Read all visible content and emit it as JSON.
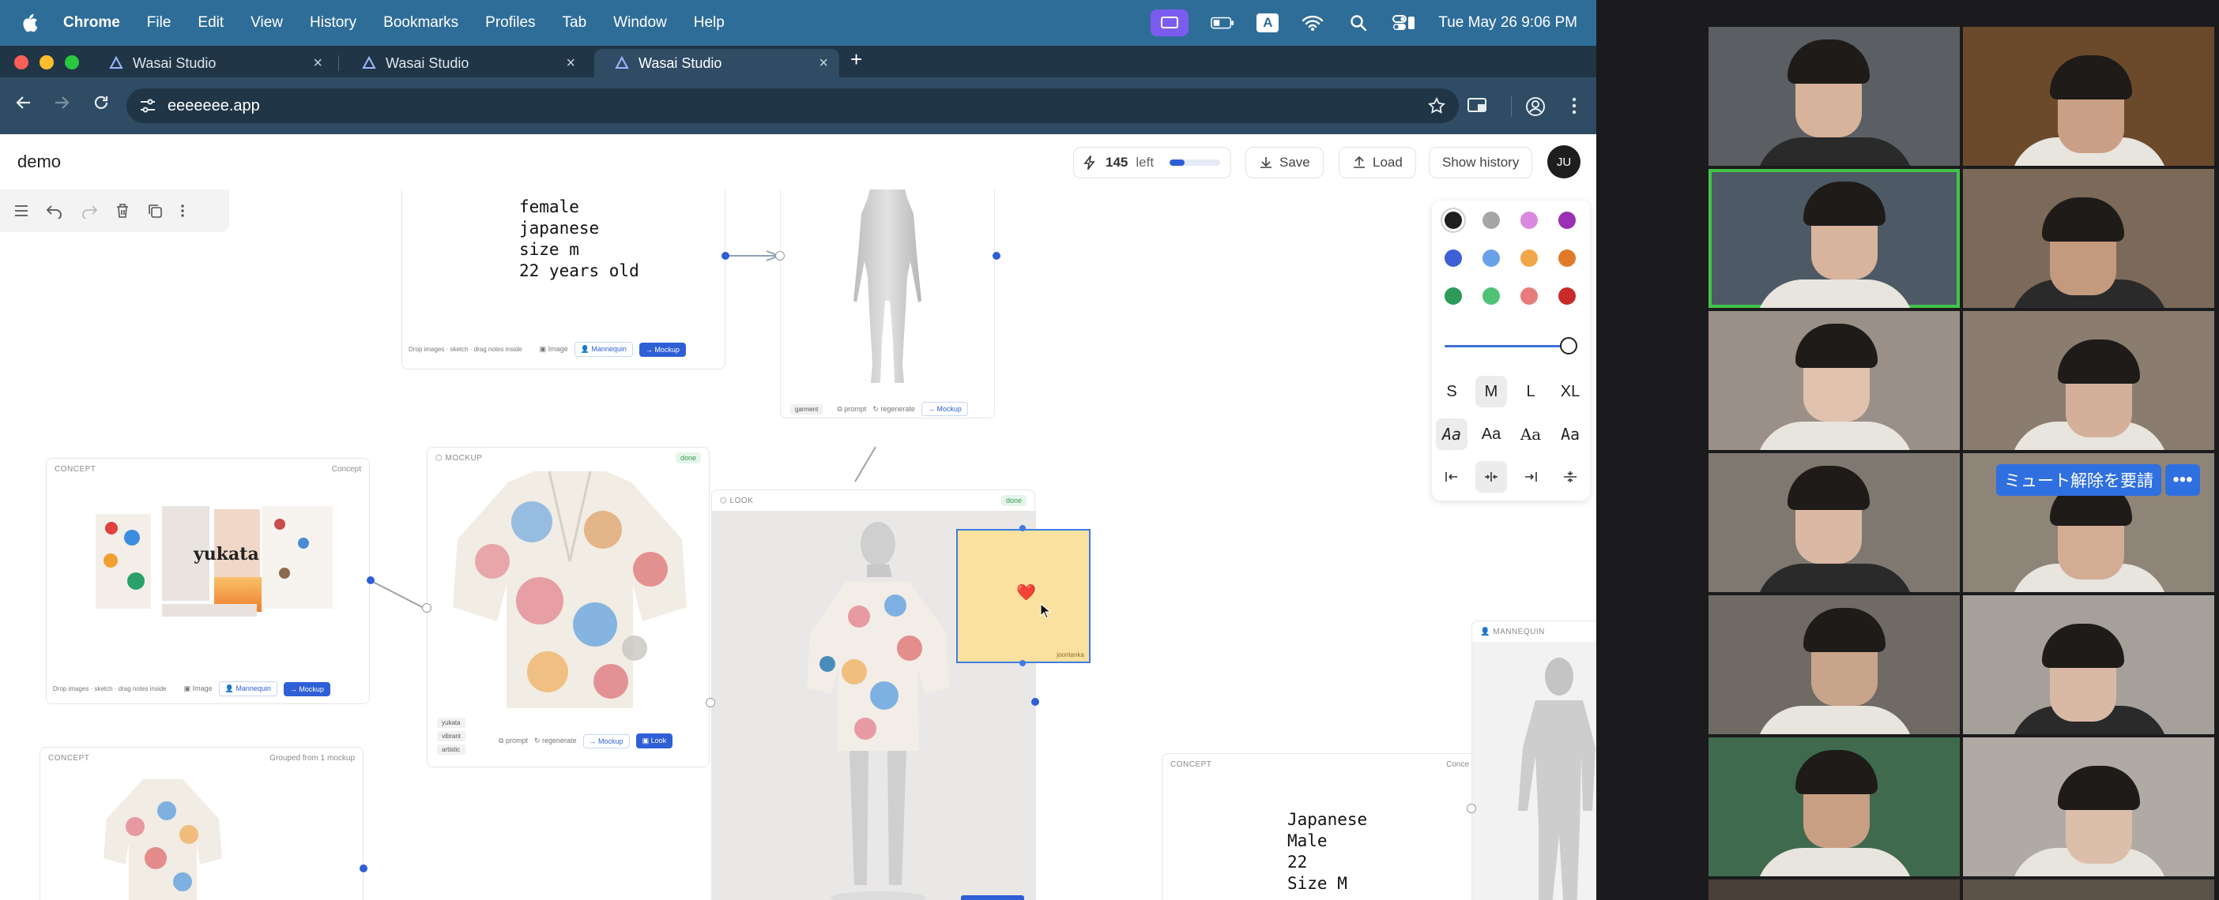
{
  "menubar": {
    "items": [
      "Chrome",
      "File",
      "Edit",
      "View",
      "History",
      "Bookmarks",
      "Profiles",
      "Tab",
      "Window",
      "Help"
    ],
    "input_badge": "A",
    "clock": "Tue May 26  9:06 PM"
  },
  "browser": {
    "tabs": [
      {
        "title": "Wasai Studio"
      },
      {
        "title": "Wasai Studio"
      },
      {
        "title": "Wasai Studio"
      }
    ],
    "url": "eeeeeee.app"
  },
  "app": {
    "title": "demo",
    "credits_count": "145",
    "credits_label": "left",
    "credits_level": 0.3,
    "save_label": "Save",
    "load_label": "Load",
    "history_label": "Show history",
    "avatar_initials": "JU"
  },
  "canvas": {
    "prompt_card": {
      "lines": [
        "female",
        "japanese",
        "size m",
        "22 years old"
      ],
      "hint": "Drop images · sketch · drag notes inside",
      "image_label": "Image",
      "mannequin_label": "Mannequin",
      "mockup_label": "→ Mockup"
    },
    "garment_card": {
      "tag": "garment",
      "prompt_label": "prompt",
      "regen_label": "regenerate",
      "mockup_label": "→ Mockup"
    },
    "concept_card": {
      "header": "CONCEPT",
      "header_right": "Concept",
      "moodboard_text": "yukata",
      "hint": "Drop images · sketch · drag notes inside",
      "image_label": "Image",
      "mannequin_label": "Mannequin",
      "mockup_label": "→ Mockup"
    },
    "mockup_card": {
      "header": "MOCKUP",
      "badge": "done",
      "tags": [
        "yukata",
        "vibrant",
        "artistic"
      ],
      "prompt_label": "prompt",
      "regen_label": "regenerate",
      "mockup_label": "→ Mockup",
      "look_label": "Look"
    },
    "look_card": {
      "header": "LOOK",
      "badge": "done"
    },
    "sticky_note": {
      "emoji": "❤️",
      "author": "joontanka"
    },
    "concept_card_2": {
      "header": "CONCEPT",
      "header_right": "Grouped from 1 mockup"
    },
    "concept_card_3": {
      "header": "CONCEPT",
      "header_right": "Conce",
      "lines": [
        "Japanese",
        "Male",
        "22",
        "Size M"
      ]
    },
    "mannequin_card": {
      "header": "MANNEQUIN"
    }
  },
  "palette": {
    "colors": [
      "#1f1f1f",
      "#a6a6a6",
      "#d98ae0",
      "#9b2fb5",
      "#3e5fd6",
      "#6aa2ea",
      "#f2a64a",
      "#e07a2a",
      "#2d9a58",
      "#4fc277",
      "#e67c7c",
      "#c92b2b"
    ],
    "stroke_width": 1.0,
    "sizes": [
      "S",
      "M",
      "L",
      "XL"
    ],
    "selected_size": "M",
    "fonts": [
      "Aa",
      "Aa",
      "Aa",
      "Aa"
    ]
  },
  "meeting": {
    "unmute_label": "ミュート解除を要請",
    "more_label": "•••"
  }
}
